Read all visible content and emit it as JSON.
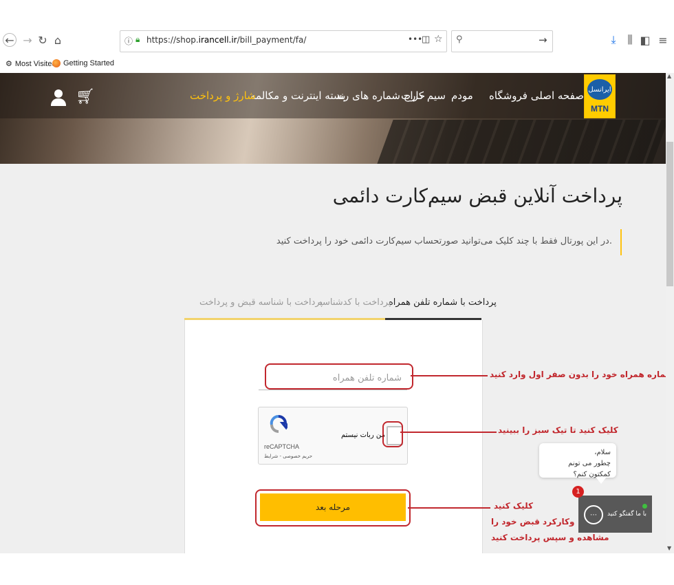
{
  "browser": {
    "url_prefix": "https://shop.",
    "url_domain": "irancell.ir",
    "url_path": "/bill_payment/fa/",
    "url_menu": "•••",
    "bookmarks": [
      {
        "label": "Most Visited",
        "icon": "gear-icon"
      },
      {
        "label": "Getting Started",
        "icon": "firefox-icon"
      }
    ]
  },
  "header": {
    "logo_top": "ایرانسل",
    "logo_bottom": "MTN",
    "nav": [
      {
        "label": "صفحه اصلی فروشگاه",
        "active": false
      },
      {
        "label": "مودم",
        "active": false
      },
      {
        "label": "سیم کارت",
        "active": false
      },
      {
        "label": "حراج شماره های رند",
        "active": false
      },
      {
        "label": "بسته اینترنت و مکالمه",
        "active": false
      },
      {
        "label": "شارژ و پرداخت",
        "active": true
      }
    ],
    "accent_color": "#ffc20e"
  },
  "page": {
    "title": "پرداخت آنلاین قبض سیم‌کارت دائمی",
    "description": "در این پورتال فقط با چند کلیک می‌توانید صورتحساب سیم‌کارت دائمی خود را پرداخت کنید.",
    "tabs": [
      {
        "label": "پرداخت با شماره تلفن همراه",
        "active": true
      },
      {
        "label": "پرداخت با کدشناسه",
        "active": false
      },
      {
        "label": "پرداخت با شناسه قبض و پرداخت",
        "active": false
      }
    ]
  },
  "form": {
    "phone_placeholder": "شماره تلفن همراه",
    "recaptcha_label": "من ربات نیستم",
    "recaptcha_brand": "reCAPTCHA",
    "recaptcha_terms": "حریم خصوصی - شرایط",
    "next_button": "مرحله بعد"
  },
  "annotations": {
    "phone": "شماره همراه خود را بدون صفر اول وارد کنید",
    "captcha": "کلیک کنید تا تیک سبز را ببینید",
    "next_line1": "کلیک کنید",
    "next_line2": "وکارکرد قبض خود را",
    "next_line3": "مشاهده و سپس پرداخت کنید",
    "color": "#c1272d"
  },
  "chat": {
    "greeting": "سلام،",
    "question": "چطور می تونم کمکتون کنم؟",
    "badge_count": "1",
    "label": "با ما گفتگو کنید"
  }
}
